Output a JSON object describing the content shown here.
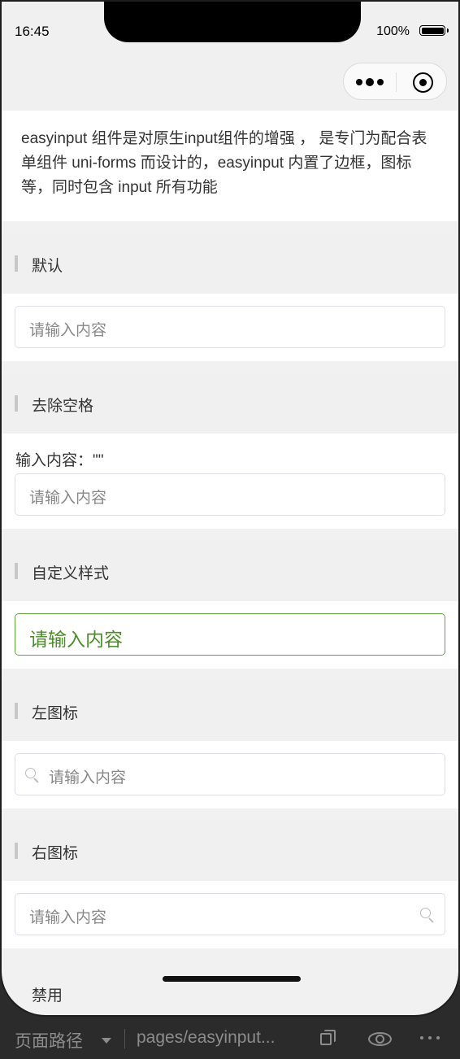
{
  "status_bar": {
    "time": "16:45",
    "battery": "100%"
  },
  "intro": "easyinput 组件是对原生input组件的增强 ， 是专门为配合表单组件 uni-forms 而设计的，easyinput 内置了边框，图标等，同时包含 input 所有功能",
  "sections": [
    {
      "title": "默认",
      "placeholder": "请输入内容"
    },
    {
      "title": "去除空格",
      "note": "输入内容：\"\"",
      "placeholder": "请输入内容"
    },
    {
      "title": "自定义样式",
      "placeholder": "请输入内容"
    },
    {
      "title": "左图标",
      "placeholder": "请输入内容"
    },
    {
      "title": "右图标",
      "placeholder": "请输入内容"
    },
    {
      "title": "禁用"
    }
  ],
  "colors": {
    "custom_border": "#62a33b",
    "custom_text": "#4b8e28"
  },
  "devtools": {
    "route_label": "页面路径",
    "path": "pages/easyinput..."
  }
}
